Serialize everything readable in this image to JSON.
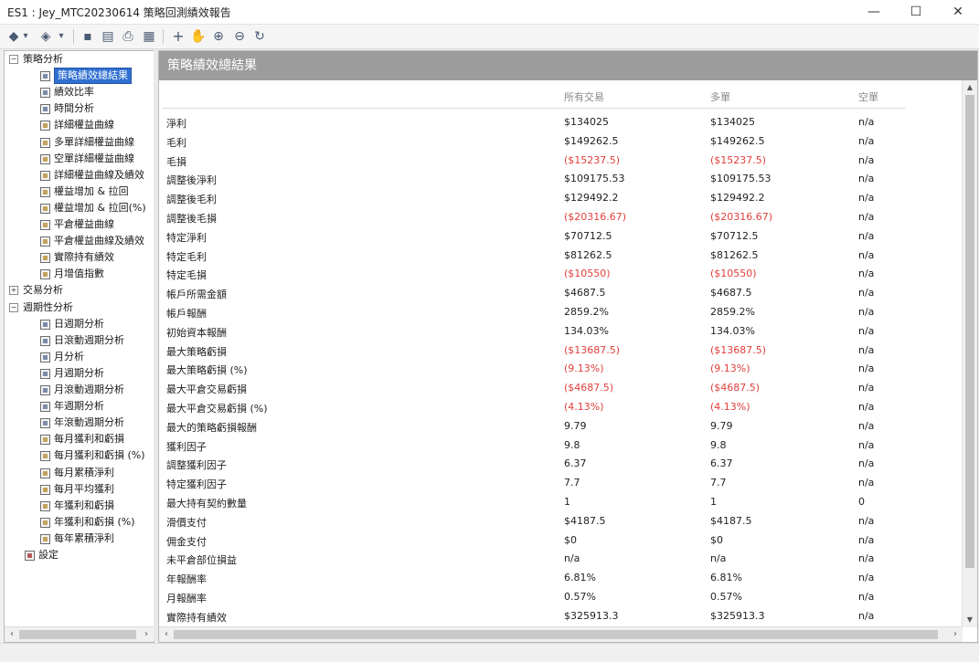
{
  "window": {
    "title": "ES1 : Jey_MTC20230614 策略回測績效報告",
    "controls": {
      "minimize": "—",
      "maximize": "☐",
      "close": "✕"
    }
  },
  "toolbar": {
    "icons": [
      "back-icon",
      "back-dropdown-icon",
      "forward-icon",
      "forward-dropdown-icon",
      "save-icon",
      "export-icon",
      "print-icon",
      "view-icon",
      "crosshair-icon",
      "hand-icon",
      "zoom-in-icon",
      "zoom-out-icon",
      "reset-icon"
    ],
    "glyphs": {
      "back": "◆",
      "dropdown": "▾",
      "forward": "◈",
      "save": "▪",
      "export": "▤",
      "print": "⎙",
      "view": "▦",
      "crosshair": "+",
      "hand": "✋",
      "zoom_in": "⊕",
      "zoom_out": "⊖",
      "reset": "↻"
    }
  },
  "tree": {
    "groups": [
      {
        "label": "策略分析",
        "expander": "−",
        "items": [
          "策略績效總結果",
          "績效比率",
          "時間分析",
          "詳細權益曲線",
          "多單詳細權益曲線",
          "空單詳細權益曲線",
          "詳細權益曲線及績效",
          "權益增加 & 拉回",
          "權益增加 & 拉回(%)",
          "平倉權益曲線",
          "平倉權益曲線及績效",
          "實際持有績效",
          "月增值指數"
        ]
      },
      {
        "label": "交易分析",
        "expander": "+",
        "items": []
      },
      {
        "label": "週期性分析",
        "expander": "−",
        "items": [
          "日週期分析",
          "日滾動週期分析",
          "月分析",
          "月週期分析",
          "月滾動週期分析",
          "年週期分析",
          "年滾動週期分析",
          "每月獲利和虧損",
          "每月獲利和虧損 (%)",
          "每月累積淨利",
          "每月平均獲利",
          "年獲利和虧損",
          "年獲利和虧損 (%)",
          "每年累積淨利"
        ]
      }
    ],
    "settings_label": "設定"
  },
  "report": {
    "section_title": "策略績效總結果",
    "columns": [
      "所有交易",
      "多單",
      "空單"
    ],
    "rows": [
      {
        "label": "淨利",
        "all": "$134025",
        "long": "$134025",
        "short": "n/a",
        "neg": false
      },
      {
        "label": "毛利",
        "all": "$149262.5",
        "long": "$149262.5",
        "short": "n/a",
        "neg": false
      },
      {
        "label": "毛損",
        "all": "($15237.5)",
        "long": "($15237.5)",
        "short": "n/a",
        "neg": true
      },
      {
        "label": "調整後淨利",
        "all": "$109175.53",
        "long": "$109175.53",
        "short": "n/a",
        "neg": false
      },
      {
        "label": "調整後毛利",
        "all": "$129492.2",
        "long": "$129492.2",
        "short": "n/a",
        "neg": false
      },
      {
        "label": "調整後毛損",
        "all": "($20316.67)",
        "long": "($20316.67)",
        "short": "n/a",
        "neg": true
      },
      {
        "label": "特定淨利",
        "all": "$70712.5",
        "long": "$70712.5",
        "short": "n/a",
        "neg": false
      },
      {
        "label": "特定毛利",
        "all": "$81262.5",
        "long": "$81262.5",
        "short": "n/a",
        "neg": false
      },
      {
        "label": "特定毛損",
        "all": "($10550)",
        "long": "($10550)",
        "short": "n/a",
        "neg": true
      },
      {
        "label": "帳戶所需金額",
        "all": "$4687.5",
        "long": "$4687.5",
        "short": "n/a",
        "neg": false
      },
      {
        "label": "帳戶報酬",
        "all": "2859.2%",
        "long": "2859.2%",
        "short": "n/a",
        "neg": false
      },
      {
        "label": "初始資本報酬",
        "all": "134.03%",
        "long": "134.03%",
        "short": "n/a",
        "neg": false
      },
      {
        "label": "最大策略虧損",
        "all": "($13687.5)",
        "long": "($13687.5)",
        "short": "n/a",
        "neg": true
      },
      {
        "label": "最大策略虧損 (%)",
        "all": "(9.13%)",
        "long": "(9.13%)",
        "short": "n/a",
        "neg": true
      },
      {
        "label": "最大平倉交易虧損",
        "all": "($4687.5)",
        "long": "($4687.5)",
        "short": "n/a",
        "neg": true
      },
      {
        "label": "最大平倉交易虧損 (%)",
        "all": "(4.13%)",
        "long": "(4.13%)",
        "short": "n/a",
        "neg": true
      },
      {
        "label": "最大的策略虧損報酬",
        "all": "9.79",
        "long": "9.79",
        "short": "n/a",
        "neg": false
      },
      {
        "label": "獲利因子",
        "all": "9.8",
        "long": "9.8",
        "short": "n/a",
        "neg": false
      },
      {
        "label": "調整獲利因子",
        "all": "6.37",
        "long": "6.37",
        "short": "n/a",
        "neg": false
      },
      {
        "label": "特定獲利因子",
        "all": "7.7",
        "long": "7.7",
        "short": "n/a",
        "neg": false
      },
      {
        "label": "最大持有契約數量",
        "all": "1",
        "long": "1",
        "short": "0",
        "neg": false
      },
      {
        "label": "滑價支付",
        "all": "$4187.5",
        "long": "$4187.5",
        "short": "n/a",
        "neg": false
      },
      {
        "label": "佣金支付",
        "all": "$0",
        "long": "$0",
        "short": "n/a",
        "neg": false
      },
      {
        "label": "未平倉部位損益",
        "all": "n/a",
        "long": "n/a",
        "short": "n/a",
        "neg": false
      },
      {
        "label": "年報酬率",
        "all": "6.81%",
        "long": "6.81%",
        "short": "n/a",
        "neg": false
      },
      {
        "label": "月報酬率",
        "all": "0.57%",
        "long": "0.57%",
        "short": "n/a",
        "neg": false
      },
      {
        "label": "實際持有績效",
        "all": "$325913.3",
        "long": "$325913.3",
        "short": "n/a",
        "neg": false
      }
    ]
  },
  "colors": {
    "negative": "#e0403c",
    "header_bg": "#9c9c9c",
    "selection": "#2f6fd1"
  }
}
